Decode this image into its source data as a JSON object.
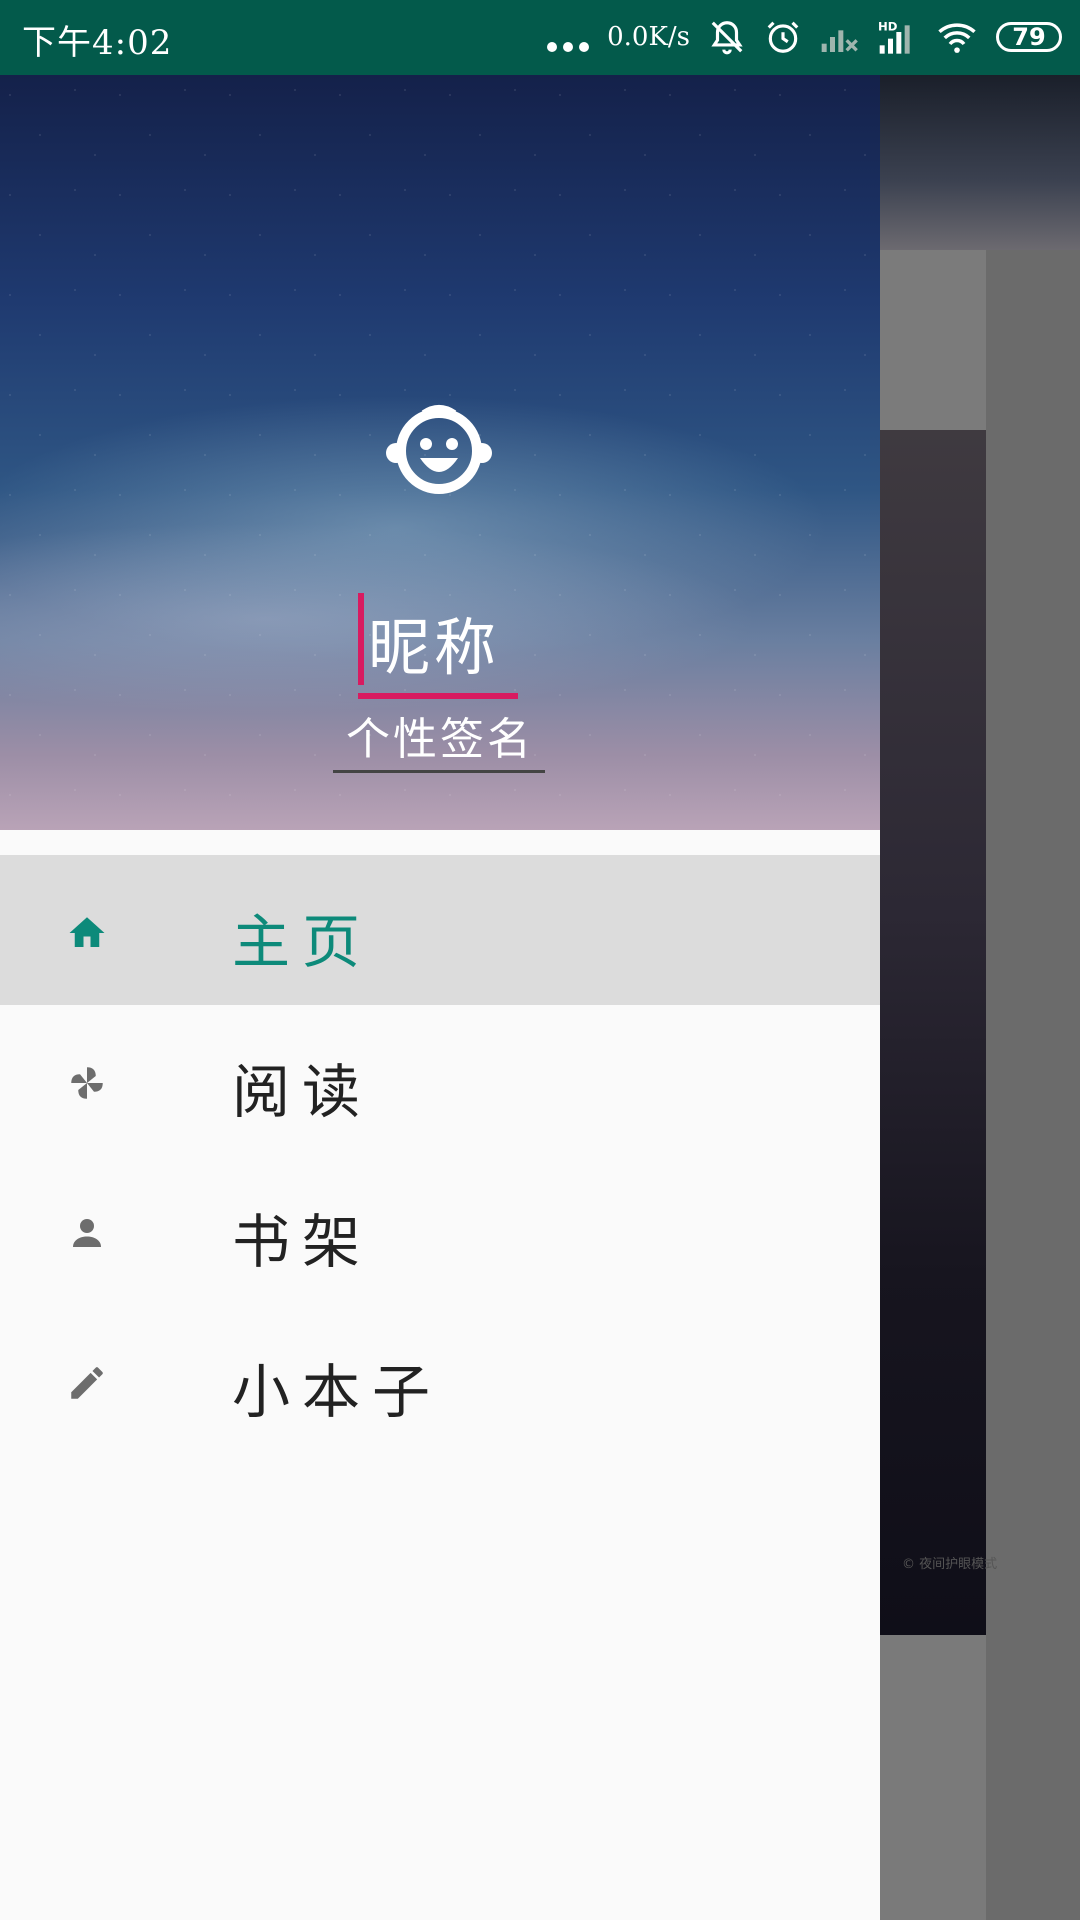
{
  "status_bar": {
    "time": "下午4:02",
    "network_speed": "0.0K/s",
    "battery": "79",
    "icons": [
      "more-dots-icon",
      "bell-muted-icon",
      "alarm-icon",
      "signal-x-icon",
      "signal-hd-icon",
      "wifi-icon",
      "battery-icon"
    ],
    "background_color": "#035a4b"
  },
  "drawer": {
    "header": {
      "avatar_icon": "baby-face-icon",
      "nickname": "昵称",
      "signature": "个性签名",
      "accent_color": "#d81b60"
    },
    "menu": {
      "items": [
        {
          "label": "主页",
          "icon": "home-icon",
          "active": true
        },
        {
          "label": "阅读",
          "icon": "pinwheel-icon",
          "active": false
        },
        {
          "label": "书架",
          "icon": "person-icon",
          "active": false
        },
        {
          "label": "小本子",
          "icon": "pencil-icon",
          "active": false
        }
      ],
      "active_color": "#0d8a7a"
    }
  },
  "background_app": {
    "caption": "© 夜间护眼模式"
  }
}
